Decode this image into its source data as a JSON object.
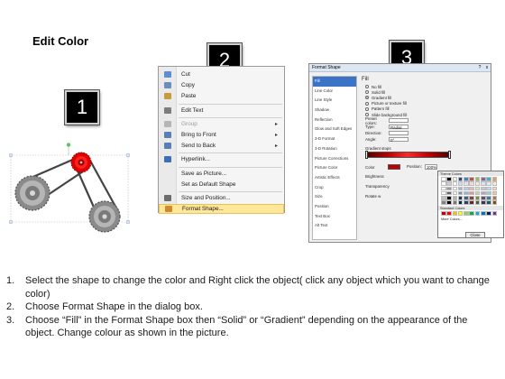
{
  "slide": {
    "title": "Edit Color"
  },
  "badges": [
    "1",
    "2",
    "3"
  ],
  "context_menu": {
    "items": [
      {
        "label": "Cut",
        "icon": "scissors-icon",
        "color": "#5b8fd1",
        "disabled": false,
        "submenu": false
      },
      {
        "label": "Copy",
        "icon": "copy-icon",
        "color": "#6b8fb8",
        "disabled": false,
        "submenu": false
      },
      {
        "label": "Paste",
        "icon": "paste-icon",
        "color": "#c79a3c",
        "disabled": false,
        "submenu": false
      },
      {
        "label": "Edit Text",
        "icon": "edit-text-icon",
        "color": "#7d7d7d",
        "disabled": false,
        "submenu": false
      },
      {
        "label": "Group",
        "icon": "group-icon",
        "color": "#b5b5b5",
        "disabled": true,
        "submenu": true
      },
      {
        "label": "Bring to Front",
        "icon": "bring-to-front-icon",
        "color": "#5a7fb5",
        "disabled": false,
        "submenu": true
      },
      {
        "label": "Send to Back",
        "icon": "send-to-back-icon",
        "color": "#5a7fb5",
        "disabled": false,
        "submenu": true
      },
      {
        "label": "Hyperlink...",
        "icon": "hyperlink-icon",
        "color": "#3c6fb8",
        "disabled": false,
        "submenu": false
      },
      {
        "label": "Save as Picture...",
        "icon": "",
        "color": "",
        "disabled": false,
        "submenu": false
      },
      {
        "label": "Set as Default Shape",
        "icon": "",
        "color": "",
        "disabled": false,
        "submenu": false
      },
      {
        "label": "Size and Position...",
        "icon": "size-position-icon",
        "color": "#6d6d6d",
        "disabled": false,
        "submenu": false
      },
      {
        "label": "Format Shape...",
        "icon": "format-shape-icon",
        "color": "#d08a2c",
        "disabled": false,
        "submenu": false,
        "highlighted": true
      }
    ]
  },
  "format_dialog": {
    "title": "Format Shape",
    "help": "?",
    "close": "x",
    "categories": [
      "Fill",
      "Line Color",
      "Line Style",
      "Shadow",
      "Reflection",
      "Glow and Soft Edges",
      "3-D Format",
      "3-D Rotation",
      "Picture Corrections",
      "Picture Color",
      "Artistic Effects",
      "Crop",
      "Size",
      "Position",
      "Text Box",
      "Alt Text"
    ],
    "selected_category": "Fill",
    "pane_heading": "Fill",
    "fill_options": [
      {
        "label": "No fill",
        "on": false
      },
      {
        "label": "Solid fill",
        "on": false
      },
      {
        "label": "Gradient fill",
        "on": true
      },
      {
        "label": "Picture or texture fill",
        "on": false
      },
      {
        "label": "Pattern fill",
        "on": false
      },
      {
        "label": "Slide background fill",
        "on": false
      }
    ],
    "fields": [
      {
        "label": "Preset colors:",
        "value": ""
      },
      {
        "label": "Type:",
        "value": "Radial"
      },
      {
        "label": "Direction:",
        "value": ""
      },
      {
        "label": "Angle:",
        "value": "0°"
      }
    ],
    "gradient_stops_label": "Gradient stops",
    "color_label": "Color",
    "position_label": "Position:",
    "position_value": "100%",
    "brightness_label": "Brightness",
    "transparency_label": "Transparency",
    "rotate_label": "Rotate w",
    "theme_colors_label": "Theme Colors",
    "standard_colors_label": "Standard Colors",
    "more_colors_label": "More Colors...",
    "close_button": "Close",
    "theme_top_row": [
      "#ffffff",
      "#000000",
      "#eeece1",
      "#1f497d",
      "#4f81bd",
      "#c0504d",
      "#9bbb59",
      "#8064a2",
      "#4bacc6",
      "#f79646"
    ],
    "standard_row": [
      "#c00000",
      "#ff0000",
      "#ffc000",
      "#ffff00",
      "#92d050",
      "#00b050",
      "#00b0f0",
      "#0070c0",
      "#002060",
      "#7030a0"
    ],
    "accent_red": "#c00000"
  },
  "instructions": [
    {
      "num": "1.",
      "text": "Select the shape to change the color and Right click the object( click any object which you want to change color)"
    },
    {
      "num": "2.",
      "text": "Choose Format Shape in the dialog box."
    },
    {
      "num": "3.",
      "text": "Choose “Fill” in the Format Shape box then “Solid” or “Gradient” depending on the appearance of the object. Change colour as shown in the picture."
    }
  ]
}
